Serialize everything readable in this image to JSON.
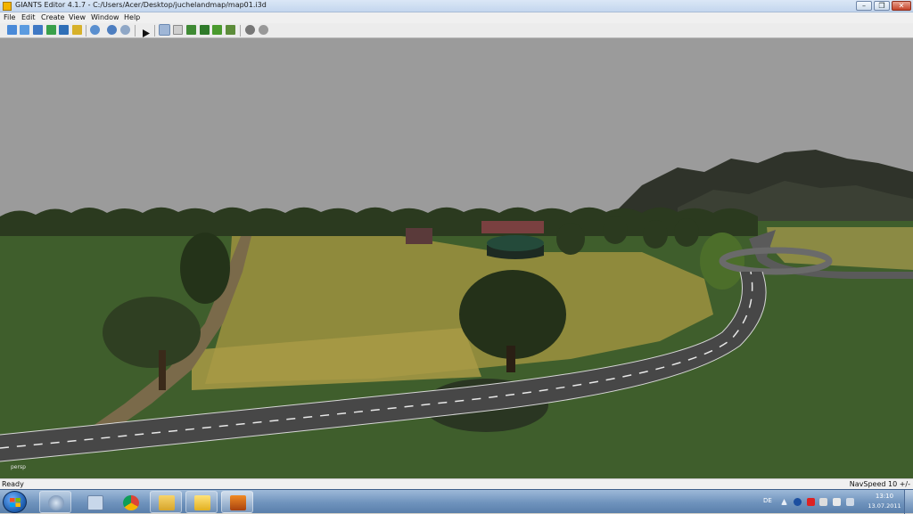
{
  "window": {
    "title": "GIANTS Editor 4.1.7 - C:/Users/Acer/Desktop/juchelandmap/map01.i3d",
    "controls": [
      "minimize-icon",
      "restore-icon",
      "close-icon"
    ],
    "minimize_glyph": "–",
    "restore_glyph": "❐",
    "close_glyph": "✕"
  },
  "menu": {
    "items": [
      "File",
      "Edit",
      "Create",
      "View",
      "Window",
      "Help"
    ]
  },
  "toolbar": {
    "icons": [
      "new-scene-icon",
      "open-icon",
      "save-icon",
      "save-as-icon",
      "export-icon",
      "import-icon",
      "refresh-icon",
      "undo-icon",
      "redo-icon",
      "play-icon",
      "select-tool-icon",
      "move-tool-icon",
      "terrain-sculpt-icon",
      "terrain-paint-icon",
      "foliage-paint-icon",
      "field-paint-icon",
      "settings-gear-icon",
      "settings-gear-alt-icon"
    ]
  },
  "viewport": {
    "camera_label": "persp",
    "colors": {
      "sky": "#9b9b9b",
      "grass": "#3f5e2c",
      "field": "#8f8a3c",
      "road": "#4a4a4a",
      "trees": "#2b3a1f",
      "mountains": "#2f332a"
    }
  },
  "status": {
    "left": "Ready",
    "right": "NavSpeed 10 +/-"
  },
  "taskbar": {
    "apps": [
      "start-orb-icon",
      "teamspeak-icon",
      "calculator-icon",
      "chrome-icon",
      "explorer-icon",
      "folder-icon",
      "giants-editor-icon"
    ],
    "language": "DE",
    "time": "13:10",
    "date": "13.07.2011"
  }
}
